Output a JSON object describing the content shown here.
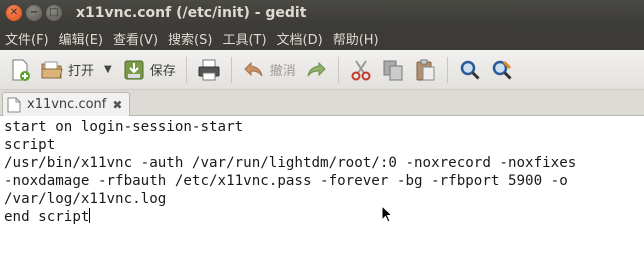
{
  "window": {
    "title": "x11vnc.conf (/etc/init) - gedit"
  },
  "menu": [
    "文件(F)",
    "编辑(E)",
    "查看(V)",
    "搜索(S)",
    "工具(T)",
    "文档(D)",
    "帮助(H)"
  ],
  "toolbar": {
    "open_label": "打开",
    "save_label": "保存",
    "undo_label": "撤消"
  },
  "tab": {
    "label": "x11vnc.conf"
  },
  "editor": {
    "lines": [
      "start on login-session-start",
      "script",
      "/usr/bin/x11vnc -auth /var/run/lightdm/root/:0 -noxrecord -noxfixes",
      "-noxdamage -rfbauth /etc/x11vnc.pass -forever -bg -rfbport 5900 -o",
      "/var/log/x11vnc.log",
      "end script"
    ]
  },
  "colors": {
    "titlebar": "#3c3b37",
    "close": "#df4a16",
    "toolbar": "#f2f1f0",
    "editor_bg": "#ffffff"
  }
}
